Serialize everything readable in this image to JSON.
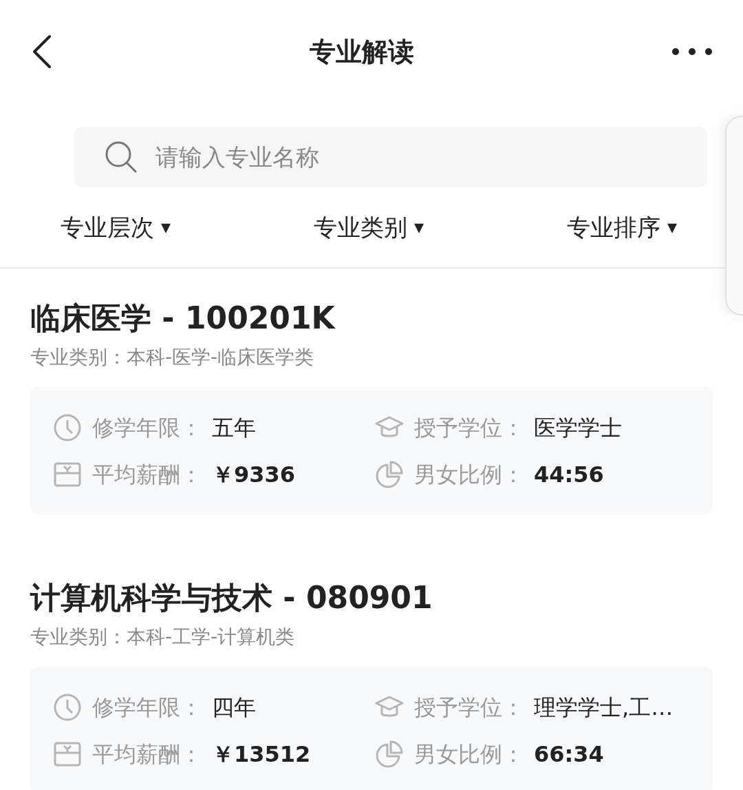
{
  "header": {
    "title": "专业解读"
  },
  "search": {
    "placeholder": "请输入专业名称"
  },
  "filters": [
    {
      "label": "专业层次",
      "symbol": "▾"
    },
    {
      "label": "专业类别",
      "symbol": "▾"
    },
    {
      "label": "专业排序",
      "symbol": "▾"
    }
  ],
  "majors": [
    {
      "title": "临床医学 - 100201K",
      "category": "专业类别：本科-医学-临床医学类",
      "fields": [
        {
          "kind": "duration",
          "label": "修学年限：",
          "value": "五年"
        },
        {
          "kind": "degree",
          "label": "授予学位：",
          "value": "医学学士"
        },
        {
          "kind": "salary",
          "label": "平均薪酬：",
          "value": "￥9336"
        },
        {
          "kind": "ratio",
          "label": "男女比例：",
          "value": "44:56"
        }
      ]
    },
    {
      "title": "计算机科学与技术 - 080901",
      "category": "专业类别：本科-工学-计算机类",
      "fields": [
        {
          "kind": "duration",
          "label": "修学年限：",
          "value": "四年"
        },
        {
          "kind": "degree",
          "label": "授予学位：",
          "value": "理学学士,工…"
        },
        {
          "kind": "salary",
          "label": "平均薪酬：",
          "value": "￥13512"
        },
        {
          "kind": "ratio",
          "label": "男女比例：",
          "value": "66:34"
        }
      ]
    }
  ]
}
